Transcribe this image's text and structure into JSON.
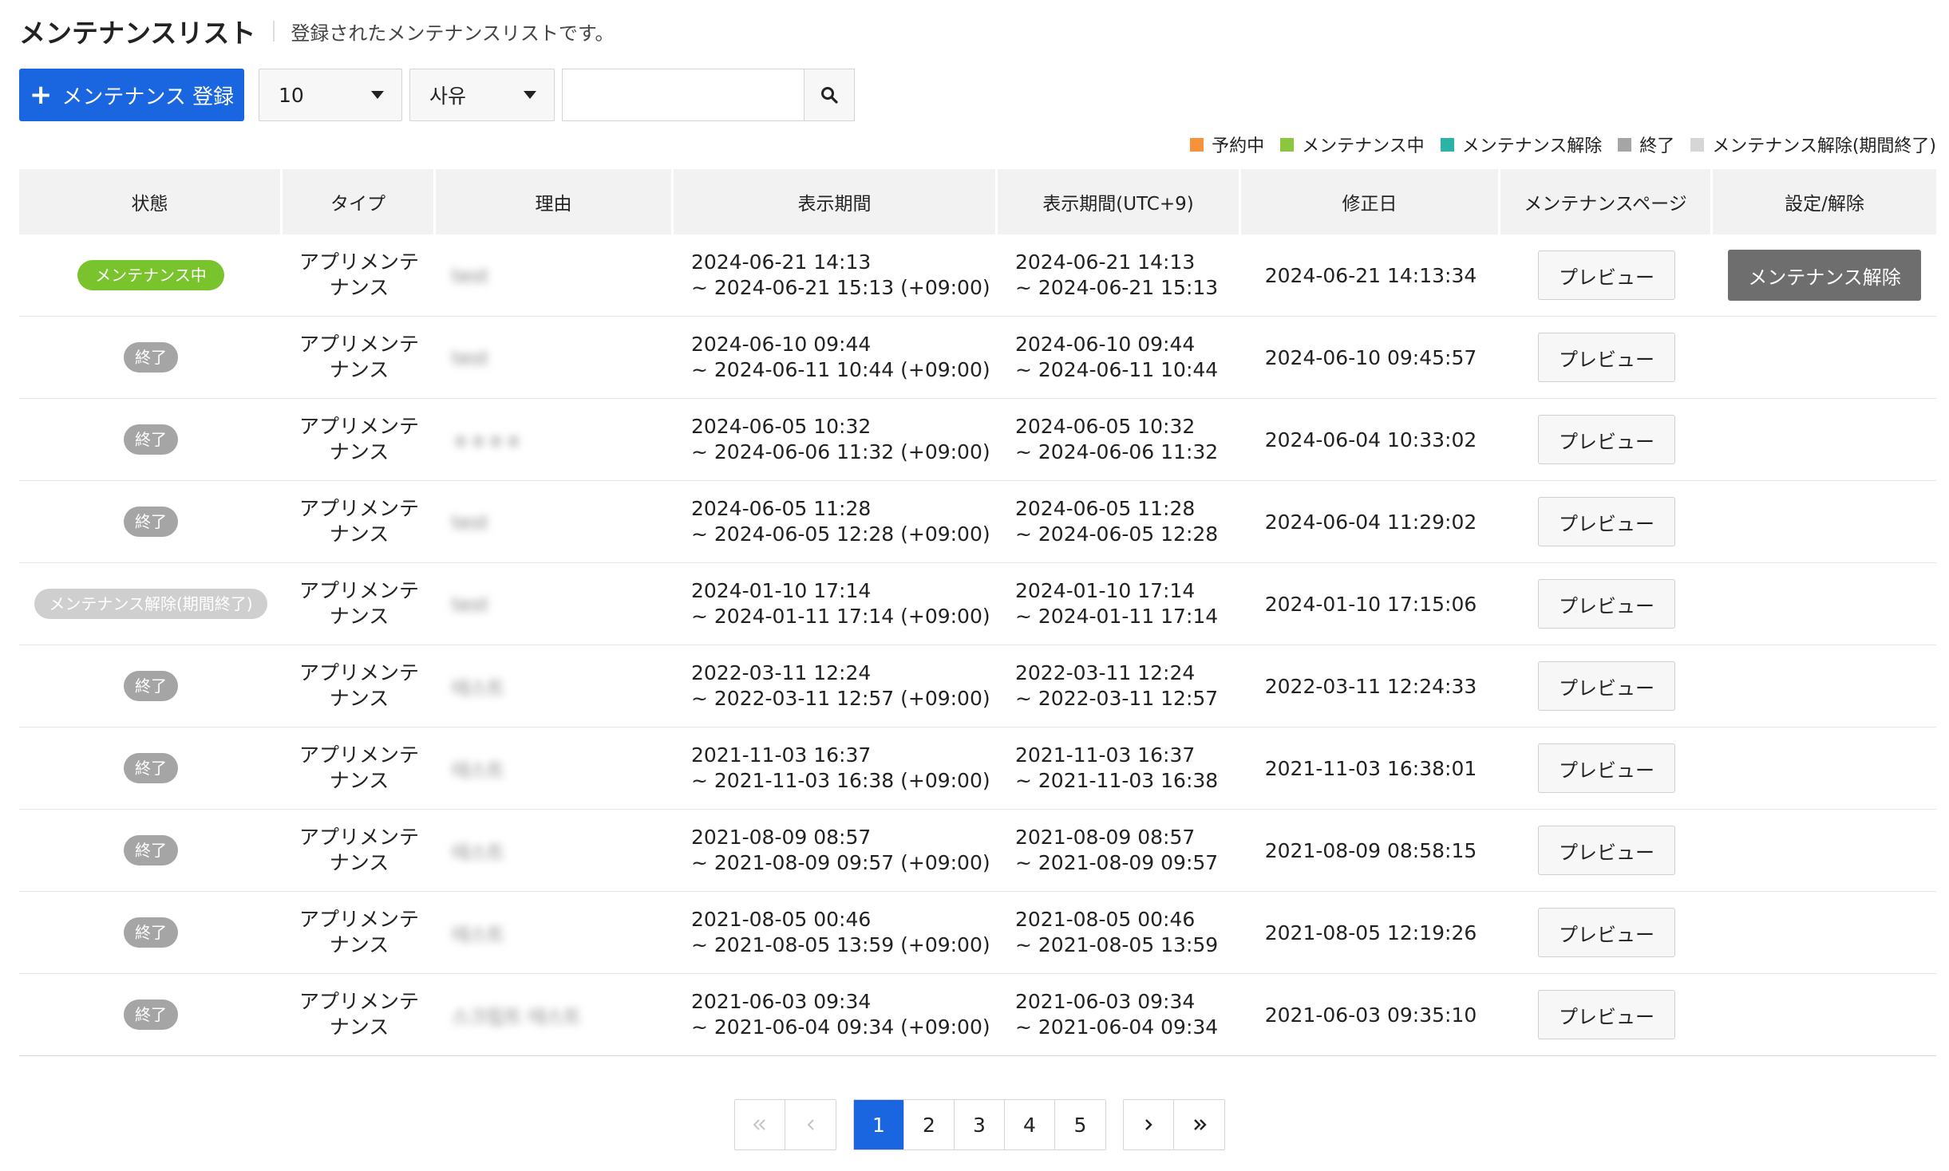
{
  "header": {
    "title": "メンテナンスリスト",
    "description": "登録されたメンテナンスリストです。"
  },
  "toolbar": {
    "register_label": "メンテナンス 登録",
    "count_value": "10",
    "type_value": "사유",
    "search_value": ""
  },
  "legend": [
    {
      "label": "予約中",
      "color": "#f7923a"
    },
    {
      "label": "メンテナンス中",
      "color": "#8cc63f"
    },
    {
      "label": "メンテナンス解除",
      "color": "#2bb3a7"
    },
    {
      "label": "終了",
      "color": "#a5a5a5"
    },
    {
      "label": "メンテナンス解除(期間終了)",
      "color": "#d6d6d6"
    }
  ],
  "table": {
    "headers": [
      "状態",
      "タイプ",
      "理由",
      "表示期間",
      "表示期間(UTC+9)",
      "修正日",
      "メンテナンスページ",
      "設定/解除"
    ],
    "preview_label": "プレビュー",
    "release_label": "メンテナンス解除",
    "rows": [
      {
        "status": "メンテナンス中",
        "status_type": "active",
        "type_line1": "アプリメンテ",
        "type_line2": "ナンス",
        "reason": "test",
        "period_start": "2024-06-21 14:13",
        "period_end": "~ 2024-06-21 15:13 (+09:00)",
        "period_utc_start": "2024-06-21 14:13",
        "period_utc_end": "~ 2024-06-21 15:13",
        "modified": "2024-06-21 14:13:34"
      },
      {
        "status": "終了",
        "status_type": "ended",
        "type_line1": "アプリメンテ",
        "type_line2": "ナンス",
        "reason": "test",
        "period_start": "2024-06-10 09:44",
        "period_end": "~ 2024-06-11 10:44 (+09:00)",
        "period_utc_start": "2024-06-10 09:44",
        "period_utc_end": "~ 2024-06-11 10:44",
        "modified": "2024-06-10 09:45:57"
      },
      {
        "status": "終了",
        "status_type": "ended",
        "type_line1": "アプリメンテ",
        "type_line2": "ナンス",
        "reason": "ㅎㅎㅎㅎ",
        "period_start": "2024-06-05 10:32",
        "period_end": "~ 2024-06-06 11:32 (+09:00)",
        "period_utc_start": "2024-06-05 10:32",
        "period_utc_end": "~ 2024-06-06 11:32",
        "modified": "2024-06-04 10:33:02"
      },
      {
        "status": "終了",
        "status_type": "ended",
        "type_line1": "アプリメンテ",
        "type_line2": "ナンス",
        "reason": "test",
        "period_start": "2024-06-05 11:28",
        "period_end": "~ 2024-06-05 12:28 (+09:00)",
        "period_utc_start": "2024-06-05 11:28",
        "period_utc_end": "~ 2024-06-05 12:28",
        "modified": "2024-06-04 11:29:02"
      },
      {
        "status": "メンテナンス解除(期間終了)",
        "status_type": "expired",
        "type_line1": "アプリメンテ",
        "type_line2": "ナンス",
        "reason": "test",
        "period_start": "2024-01-10 17:14",
        "period_end": "~ 2024-01-11 17:14 (+09:00)",
        "period_utc_start": "2024-01-10 17:14",
        "period_utc_end": "~ 2024-01-11 17:14",
        "modified": "2024-01-10 17:15:06"
      },
      {
        "status": "終了",
        "status_type": "ended",
        "type_line1": "アプリメンテ",
        "type_line2": "ナンス",
        "reason": "테스트",
        "period_start": "2022-03-11 12:24",
        "period_end": "~ 2022-03-11 12:57 (+09:00)",
        "period_utc_start": "2022-03-11 12:24",
        "period_utc_end": "~ 2022-03-11 12:57",
        "modified": "2022-03-11 12:24:33"
      },
      {
        "status": "終了",
        "status_type": "ended",
        "type_line1": "アプリメンテ",
        "type_line2": "ナンス",
        "reason": "테스트",
        "period_start": "2021-11-03 16:37",
        "period_end": "~ 2021-11-03 16:38 (+09:00)",
        "period_utc_start": "2021-11-03 16:37",
        "period_utc_end": "~ 2021-11-03 16:38",
        "modified": "2021-11-03 16:38:01"
      },
      {
        "status": "終了",
        "status_type": "ended",
        "type_line1": "アプリメンテ",
        "type_line2": "ナンス",
        "reason": "테스트",
        "period_start": "2021-08-09 08:57",
        "period_end": "~ 2021-08-09 09:57 (+09:00)",
        "period_utc_start": "2021-08-09 08:57",
        "period_utc_end": "~ 2021-08-09 09:57",
        "modified": "2021-08-09 08:58:15"
      },
      {
        "status": "終了",
        "status_type": "ended",
        "type_line1": "アプリメンテ",
        "type_line2": "ナンス",
        "reason": "테스트",
        "period_start": "2021-08-05 00:46",
        "period_end": "~ 2021-08-05 13:59 (+09:00)",
        "period_utc_start": "2021-08-05 00:46",
        "period_utc_end": "~ 2021-08-05 13:59",
        "modified": "2021-08-05 12:19:26"
      },
      {
        "status": "終了",
        "status_type": "ended",
        "type_line1": "アプリメンテ",
        "type_line2": "ナンス",
        "reason": "스크립트 테스트",
        "period_start": "2021-06-03 09:34",
        "period_end": "~ 2021-06-04 09:34 (+09:00)",
        "period_utc_start": "2021-06-03 09:34",
        "period_utc_end": "~ 2021-06-04 09:34",
        "modified": "2021-06-03 09:35:10"
      }
    ]
  },
  "pagination": {
    "pages": [
      "1",
      "2",
      "3",
      "4",
      "5"
    ],
    "current": "1"
  }
}
